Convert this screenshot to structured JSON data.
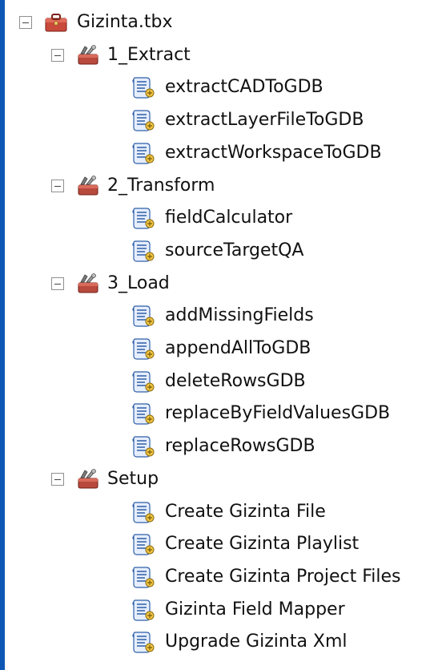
{
  "toolbox": {
    "name": "Gizinta.tbx",
    "icon": "toolbox-icon",
    "accent": "#c0392b"
  },
  "toolsets": [
    {
      "name": "1_Extract",
      "icon": "toolset-icon",
      "tools": [
        "extractCADToGDB",
        "extractLayerFileToGDB",
        "extractWorkspaceToGDB"
      ]
    },
    {
      "name": "2_Transform",
      "icon": "toolset-icon",
      "tools": [
        "fieldCalculator",
        "sourceTargetQA"
      ]
    },
    {
      "name": "3_Load",
      "icon": "toolset-icon",
      "tools": [
        "addMissingFields",
        "appendAllToGDB",
        "deleteRowsGDB",
        "replaceByFieldValuesGDB",
        "replaceRowsGDB"
      ]
    },
    {
      "name": "Setup",
      "icon": "toolset-icon",
      "tools": [
        "Create Gizinta File",
        "Create Gizinta Playlist",
        "Create Gizinta Project Files",
        "Gizinta Field Mapper",
        "Upgrade Gizinta Xml"
      ]
    }
  ],
  "tool_icon": "script-tool-icon",
  "collapse_icon": "collapse-minus-icon"
}
